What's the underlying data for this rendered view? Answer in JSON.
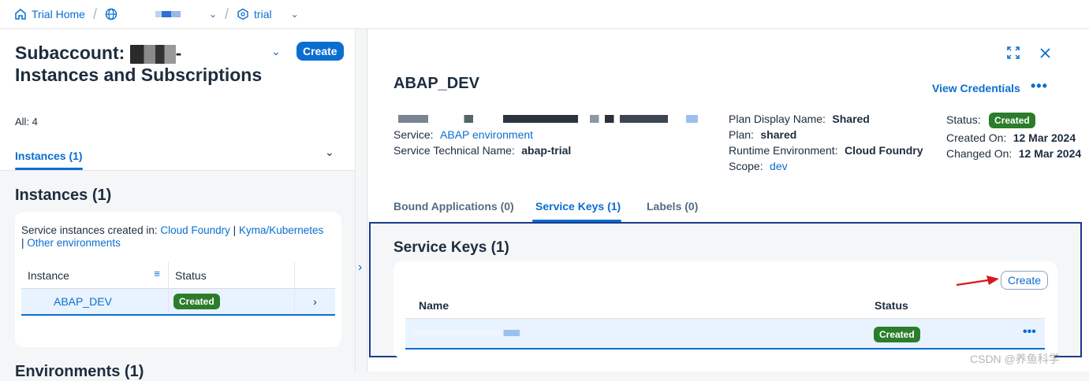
{
  "topbar": {
    "home_label": "Trial Home",
    "trial_label": "trial"
  },
  "left": {
    "title_prefix": "Subaccount:",
    "title_rest": "Instances and Subscriptions",
    "count": "All: 4",
    "create_label": "Create",
    "tab_label": "Instances (1)",
    "section_title": "Instances (1)",
    "env_text": "Service instances created in:",
    "env_cf": "Cloud Foundry",
    "env_kyma": "Kyma/Kubernetes",
    "env_other": "Other environments",
    "col_instance": "Instance",
    "col_status": "Status",
    "row_name": "ABAP_DEV",
    "row_status": "Created",
    "next_title": "Environments (1)"
  },
  "detail": {
    "title": "ABAP_DEV",
    "view_credentials": "View Credentials",
    "service_label": "Service:",
    "service_value": "ABAP environment",
    "tech_label": "Service Technical Name:",
    "tech_value": "abap-trial",
    "plan_display_label": "Plan Display Name:",
    "plan_display_value": "Shared",
    "plan_label": "Plan:",
    "plan_value": "shared",
    "runtime_label": "Runtime Environment:",
    "runtime_value": "Cloud Foundry",
    "scope_label": "Scope:",
    "scope_value": "dev",
    "status_label": "Status:",
    "status_value": "Created",
    "created_label": "Created On:",
    "created_value": "12 Mar 2024",
    "changed_label": "Changed On:",
    "changed_value": "12 Mar 2024",
    "tabs": [
      {
        "label": "Bound Applications (0)"
      },
      {
        "label": "Service Keys (1)"
      },
      {
        "label": "Labels (0)"
      }
    ],
    "keys_title": "Service Keys (1)",
    "keys_create": "Create",
    "col_name": "Name",
    "col_status": "Status",
    "key_status": "Created"
  },
  "watermark": "CSDN @养鱼科学"
}
